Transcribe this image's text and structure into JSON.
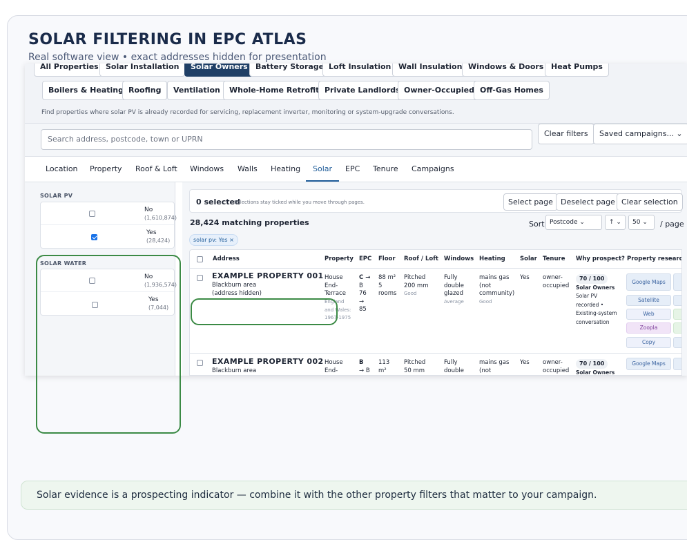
{
  "slide": {
    "title": "SOLAR FILTERING IN EPC ATLAS",
    "subtitle": "Real software view • exact addresses hidden for presentation",
    "footer": "Solar evidence is a prospecting indicator — combine it with the other property filters that matter to your campaign."
  },
  "presets": {
    "row1": [
      "All Properties",
      "Solar Installation",
      "Solar Owners",
      "Battery Storage",
      "Loft Insulation",
      "Wall Insulation",
      "Windows & Doors",
      "Heat Pumps"
    ],
    "row2": [
      "Boilers & Heating",
      "Roofing",
      "Ventilation",
      "Whole-Home Retrofit",
      "Private Landlords",
      "Owner-Occupied",
      "Off-Gas Homes"
    ],
    "active": "Solar Owners",
    "help": "Find properties where solar PV is already recorded for servicing, replacement inverter, monitoring or system-upgrade conversations."
  },
  "search": {
    "placeholder": "Search address, postcode, town or UPRN",
    "clear_label": "Clear filters",
    "saved_label": "Saved campaigns... ⌄"
  },
  "tabs": [
    "Location",
    "Property",
    "Roof & Loft",
    "Windows",
    "Walls",
    "Heating",
    "Solar",
    "EPC",
    "Tenure",
    "Campaigns"
  ],
  "active_tab": "Solar",
  "sidebar": {
    "solar_pv": {
      "title": "SOLAR PV",
      "options": [
        {
          "label": "No",
          "count": "(1,610,874)",
          "checked": false
        },
        {
          "label": "Yes",
          "count": "(28,424)",
          "checked": true
        }
      ]
    },
    "solar_water": {
      "title": "SOLAR WATER",
      "options": [
        {
          "label": "No",
          "count": "(1,936,574)",
          "checked": false
        },
        {
          "label": "Yes",
          "count": "(7,044)",
          "checked": false
        }
      ]
    }
  },
  "results": {
    "selected": "0 selected",
    "selected_hint": "Selections stay ticked while you move through pages.",
    "select_page": "Select page",
    "deselect_page": "Deselect page",
    "clear_selection": "Clear selection",
    "matching": "28,424 matching properties",
    "sort_label": "Sort",
    "sort_value": "Postcode ⌄",
    "sort_dir": "↑ ⌄",
    "per_page": "50 ⌄",
    "per_page_label": "/ page",
    "chip": "solar pv: Yes ×"
  },
  "table": {
    "headers": [
      "Address",
      "Property",
      "EPC",
      "Floor",
      "Roof / Loft",
      "Windows",
      "Heating",
      "Solar",
      "Tenure",
      "Why prospect?",
      "Property research"
    ],
    "rows": [
      {
        "title": "EXAMPLE PROPERTY 001",
        "area": "Blackburn area",
        "hidden": "(address hidden)",
        "property": [
          "House",
          "End-",
          "Terrace"
        ],
        "property_note": [
          "England",
          "and Wales:",
          "1967-1975"
        ],
        "epc": [
          "C →",
          "B",
          "76",
          "→",
          "85"
        ],
        "floor": [
          "88 m²",
          "5",
          "rooms"
        ],
        "roof": [
          "Pitched",
          "200 mm"
        ],
        "roof_note": "Good",
        "windows": [
          "Fully",
          "double",
          "glazed"
        ],
        "windows_note": "Average",
        "heating": [
          "mains gas",
          "(not",
          "community)"
        ],
        "heating_note": "Good",
        "solar": "Yes",
        "tenure": [
          "owner-",
          "occupied"
        ],
        "score": "70 / 100",
        "reason_title": "Solar Owners",
        "reason": [
          "Solar PV",
          "recorded •",
          "Existing-system",
          "conversation"
        ],
        "research": [
          "Google Maps",
          "Satellite",
          "Web",
          "Zoopla",
          "Copy"
        ]
      },
      {
        "title": "EXAMPLE PROPERTY 002",
        "area": "Blackburn area",
        "property": [
          "House",
          "End-"
        ],
        "epc": [
          "B",
          "→ B"
        ],
        "floor": [
          "113",
          "m²"
        ],
        "roof": [
          "Pitched",
          "50 mm"
        ],
        "windows": [
          "Fully",
          "double"
        ],
        "heating": [
          "mains gas",
          "(not"
        ],
        "solar": "Yes",
        "tenure": [
          "owner-",
          "occupied"
        ],
        "score": "70 / 100",
        "reason_title": "Solar Owners",
        "research": [
          "Google Maps"
        ]
      }
    ]
  },
  "colors": {
    "accent": "#1f3f66",
    "highlight": "#3b8a45",
    "link": "#1f5c99"
  }
}
